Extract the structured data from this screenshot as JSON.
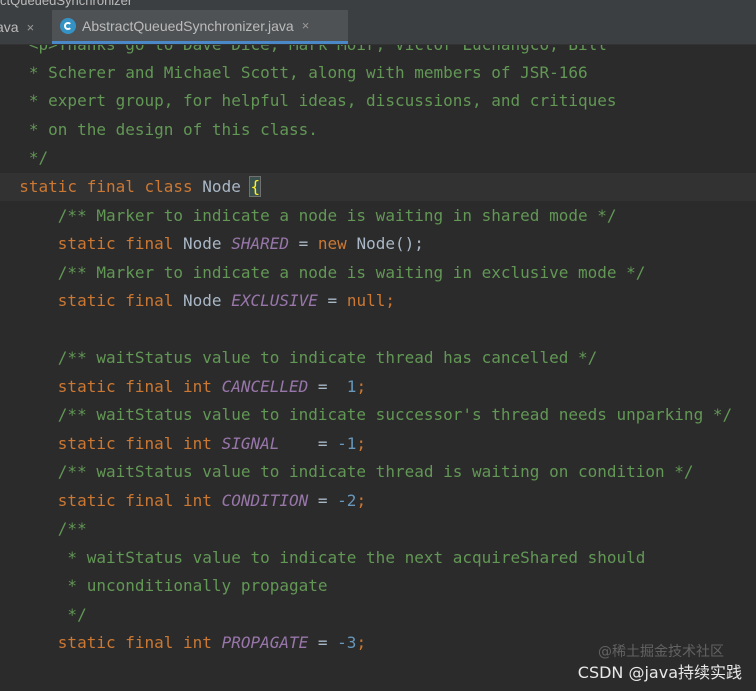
{
  "window": {
    "title": "ctQueuedSynchronizer"
  },
  "tabs": [
    {
      "label": "ava",
      "close": "×"
    },
    {
      "label": "AbstractQueuedSynchronizer.java",
      "close": "×",
      "icon": "java-class-icon"
    }
  ],
  "code": {
    "line0": {
      "text": "   <p>Thanks go to Dave Dice, Mark Moir, Victor Luchangco, Bill"
    },
    "line1": {
      "text": "   * Scherer and Michael Scott, along with members of JSR-166"
    },
    "line2": {
      "text": "   * expert group, for helpful ideas, discussions, and critiques"
    },
    "line3": {
      "text": "   * on the design of this class."
    },
    "line4": {
      "text": "   */"
    },
    "line5": {
      "kw": "  static final class ",
      "name": "Node ",
      "brace": "{"
    },
    "line6": {
      "doc": "      /** Marker to indicate a node is waiting in shared mode */"
    },
    "line7": {
      "kw": "      static final ",
      "type": "Node ",
      "field": "SHARED",
      "eq": " = ",
      "new": "new ",
      "ctor": "Node",
      "rest": "();"
    },
    "line8": {
      "doc": "      /** Marker to indicate a node is waiting in exclusive mode */"
    },
    "line9": {
      "kw": "      static final ",
      "type": "Node ",
      "field": "EXCLUSIVE",
      "eq": " = ",
      "null": "null",
      "semi": ";"
    },
    "line11": {
      "doc": "      /** waitStatus value to indicate thread has cancelled */"
    },
    "line12": {
      "kw": "      static final int ",
      "field": "CANCELLED",
      "eq": " =  ",
      "num": "1",
      "semi": ";"
    },
    "line13": {
      "doc": "      /** waitStatus value to indicate successor's thread needs unparking */"
    },
    "line14": {
      "kw": "      static final int ",
      "field": "SIGNAL",
      "eq": "    = ",
      "num": "-1",
      "semi": ";"
    },
    "line15": {
      "doc": "      /** waitStatus value to indicate thread is waiting on condition */"
    },
    "line16": {
      "kw": "      static final int ",
      "field": "CONDITION",
      "eq": " = ",
      "num": "-2",
      "semi": ";"
    },
    "line17": {
      "doc": "      /**"
    },
    "line18": {
      "doc": "       * waitStatus value to indicate the next acquireShared should"
    },
    "line19": {
      "doc": "       * unconditionally propagate"
    },
    "line20": {
      "doc": "       */"
    },
    "line21": {
      "kw": "      static final int ",
      "field": "PROPAGATE",
      "eq": " = ",
      "num": "-3",
      "semi": ";"
    }
  },
  "watermark": {
    "main": "CSDN @java持续实践",
    "faint": "@稀土掘金技术社区"
  }
}
